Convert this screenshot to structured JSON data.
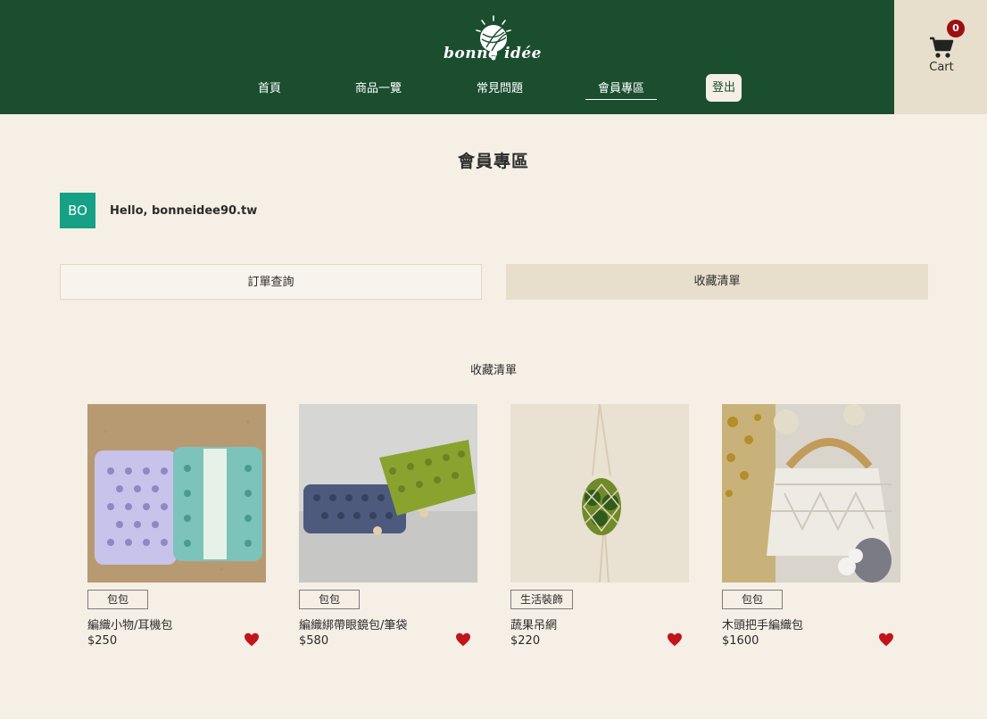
{
  "header": {
    "logo": {
      "left": "bonne",
      "right": "idée"
    },
    "nav": [
      {
        "label": "首頁",
        "active": false
      },
      {
        "label": "商品一覽",
        "active": false
      },
      {
        "label": "常見問題",
        "active": false
      },
      {
        "label": "會員專區",
        "active": true
      }
    ],
    "logout_label": "登出",
    "cart": {
      "label": "Cart",
      "count": "0"
    }
  },
  "page": {
    "title": "會員專區",
    "avatar_initials": "BO",
    "greeting": "Hello, bonneidee90.tw",
    "tabs": [
      {
        "label": "訂單查詢",
        "selected": false
      },
      {
        "label": "收藏清單",
        "selected": true
      }
    ],
    "section_title": "收藏清單"
  },
  "favorites": [
    {
      "category": "包包",
      "name": "編織小物/耳機包",
      "price": "$250"
    },
    {
      "category": "包包",
      "name": "編織綁帶眼鏡包/筆袋",
      "price": "$580"
    },
    {
      "category": "生活裝飾",
      "name": "蔬果吊網",
      "price": "$220"
    },
    {
      "category": "包包",
      "name": "木頭把手編織包",
      "price": "$1600"
    }
  ],
  "colors": {
    "header_bg": "#1b4e2f",
    "page_bg": "#f5efe6",
    "cart_bg": "#e7dfcc",
    "badge": "#9b1010",
    "avatar": "#16a085",
    "heart": "#c0161b"
  }
}
